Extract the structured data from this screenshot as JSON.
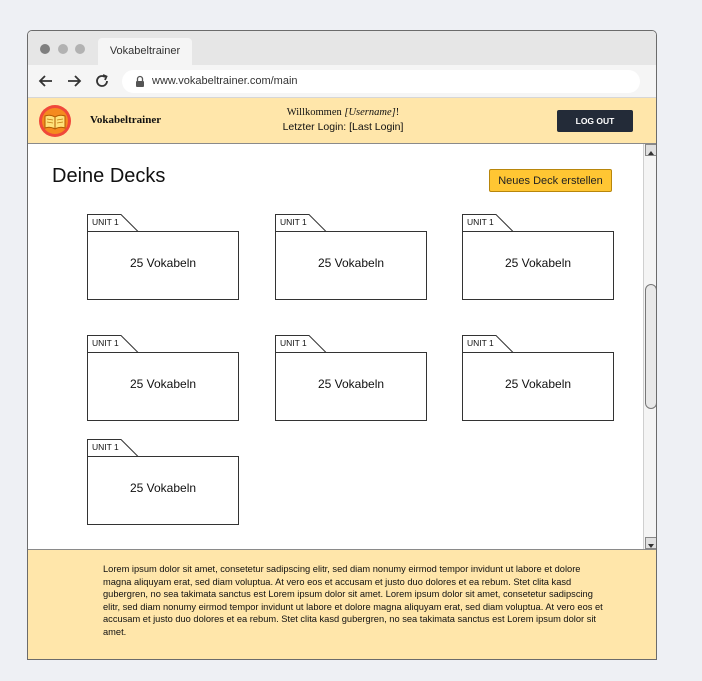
{
  "browser": {
    "tab_title": "Vokabeltrainer",
    "url": "www.vokabeltrainer.com/main"
  },
  "header": {
    "brand": "Vokabeltrainer",
    "welcome_prefix": "Willkommen ",
    "username": "[Username]",
    "welcome_suffix": "!",
    "last_login": "Letzter Login: [Last Login]",
    "logout_label": "LOG OUT"
  },
  "main": {
    "title": "Deine Decks",
    "new_deck_label": "Neues Deck erstellen",
    "decks": [
      {
        "unit": "UNIT 1",
        "count": "25 Vokabeln"
      },
      {
        "unit": "UNIT 1",
        "count": "25 Vokabeln"
      },
      {
        "unit": "UNIT 1",
        "count": "25 Vokabeln"
      },
      {
        "unit": "UNIT 1",
        "count": "25 Vokabeln"
      },
      {
        "unit": "UNIT 1",
        "count": "25 Vokabeln"
      },
      {
        "unit": "UNIT 1",
        "count": "25 Vokabeln"
      },
      {
        "unit": "UNIT 1",
        "count": "25 Vokabeln"
      }
    ]
  },
  "footer": {
    "text": "Lorem ipsum dolor sit amet, consetetur sadipscing elitr, sed diam nonumy eirmod tempor invidunt ut labore et dolore magna aliquyam erat, sed diam voluptua. At vero eos et accusam et justo duo dolores et ea rebum. Stet clita kasd gubergren, no sea takimata sanctus est Lorem ipsum dolor sit amet. Lorem ipsum dolor sit amet, consetetur sadipscing elitr, sed diam nonumy eirmod tempor invidunt ut labore et dolore magna aliquyam erat, sed diam voluptua. At vero eos et accusam et justo duo dolores et ea rebum. Stet clita kasd gubergren, no sea takimata sanctus est Lorem ipsum dolor sit amet."
  },
  "colors": {
    "header_bg": "#ffe6aa",
    "accent_button": "#ffc633",
    "logout_bg": "#232b38"
  },
  "icons": [
    "back-arrow-icon",
    "forward-arrow-icon",
    "reload-icon",
    "lock-icon",
    "book-logo-icon",
    "scroll-up-icon",
    "scroll-down-icon"
  ]
}
